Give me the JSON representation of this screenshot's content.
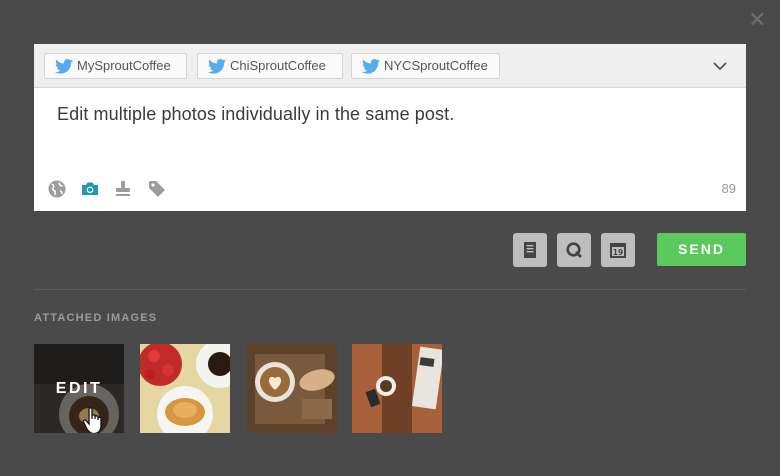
{
  "dialog": {
    "close_icon": "close-icon"
  },
  "profiles": [
    {
      "name": "MySproutCoffee",
      "icon": "twitter-bird-icon"
    },
    {
      "name": "ChiSproutCoffee",
      "icon": "twitter-bird-icon"
    },
    {
      "name": "NYCSproutCoffee",
      "icon": "twitter-bird-icon"
    }
  ],
  "composer": {
    "message": "Edit multiple photos individually in the same post.",
    "char_count": "89",
    "tools": [
      "globe-icon",
      "camera-icon",
      "stamp-icon",
      "tag-icon"
    ],
    "active_tool": "camera-icon"
  },
  "actions": {
    "buttons": [
      "notes-icon",
      "queue-icon",
      "calendar-icon"
    ],
    "calendar_day": "19",
    "send_label": "SEND"
  },
  "attached": {
    "label": "ATTACHED IMAGES",
    "edit_label": "EDIT",
    "images": [
      "latte-art-photo",
      "strawberries-croissant-photo",
      "latte-heart-table-photo",
      "coffee-table-photo"
    ]
  },
  "colors": {
    "background": "#4a4a4a",
    "twitter_blue": "#55acee",
    "active_tool": "#1a9bb0",
    "send_green": "#5cc95c"
  }
}
